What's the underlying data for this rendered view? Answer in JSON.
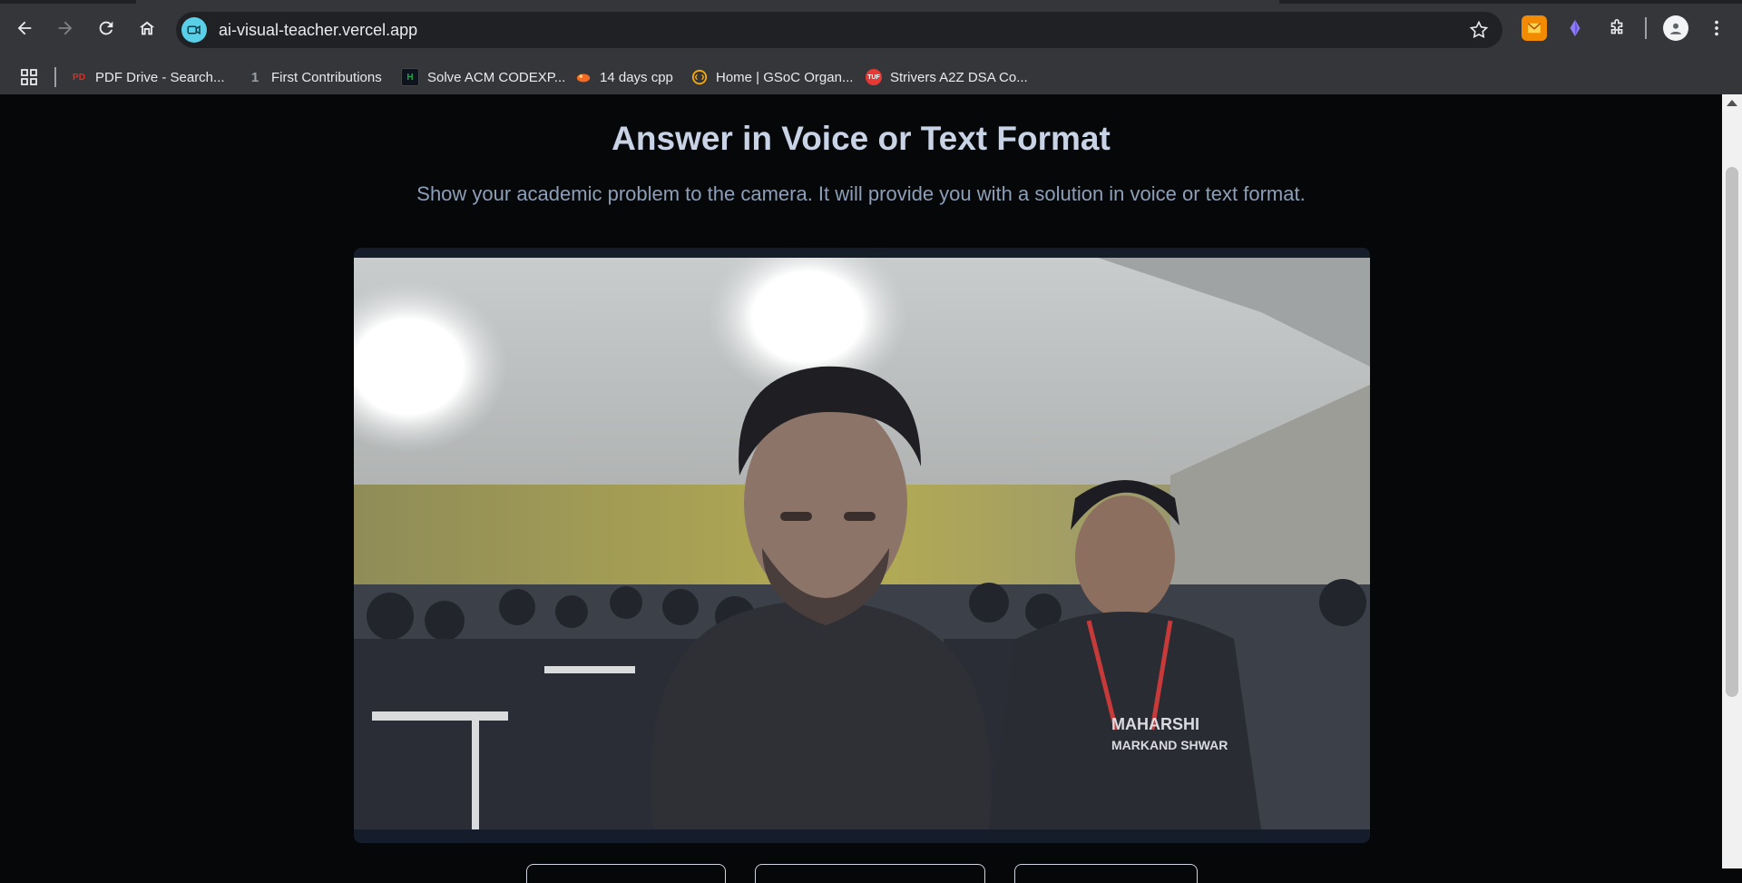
{
  "browser": {
    "url": "ai-visual-teacher.vercel.app",
    "bookmarks": [
      {
        "label": "PDF Drive - Search...",
        "icon": "pdf-drive-icon",
        "color": "#d93025"
      },
      {
        "label": "First Contributions",
        "icon": "first-contributions-icon",
        "color": "#202124"
      },
      {
        "label": "Solve ACM CODEXP...",
        "icon": "hackerrank-icon",
        "color": "#1ba94c"
      },
      {
        "label": "14 days cpp",
        "icon": "cpp-course-icon",
        "color": "#f26b21"
      },
      {
        "label": "Home | GSoC Organ...",
        "icon": "gsoc-icon",
        "color": "#f9ab00"
      },
      {
        "label": "Strivers A2Z DSA Co...",
        "icon": "tuf-icon",
        "color": "#e53935"
      }
    ]
  },
  "page": {
    "title": "Answer in Voice or Text Format",
    "subtitle": "Show your academic problem to the camera. It will provide you with a solution in voice or text format."
  },
  "colors": {
    "background": "#060709",
    "title": "#c9d3e6",
    "subtitle": "#8d9fb8",
    "video_frame": "#151c2a"
  }
}
